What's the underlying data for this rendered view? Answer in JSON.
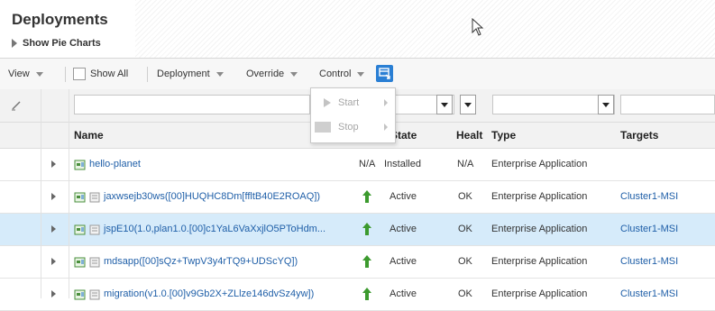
{
  "header": {
    "title": "Deployments",
    "show_pie_charts": "Show Pie Charts"
  },
  "toolbar": {
    "view": "View",
    "show_all": "Show All",
    "deployment": "Deployment",
    "override": "Override",
    "control": "Control"
  },
  "control_menu": {
    "items": [
      "Start",
      "Stop"
    ]
  },
  "table": {
    "columns": [
      "Name",
      "State",
      "Healt",
      "Type",
      "Targets"
    ],
    "rows": [
      {
        "name": "hello-planet",
        "status": "N/A",
        "state": "Installed",
        "health": "N/A",
        "type": "Enterprise Application",
        "targets": ""
      },
      {
        "name": "jaxwsejb30ws([00]HUQHC8Dm[ffltB40E2ROAQ])",
        "status": "up",
        "state": "Active",
        "health": "OK",
        "type": "Enterprise Application",
        "targets": "Cluster1-MSI"
      },
      {
        "name": "jspE10(1.0,plan1.0.[00]c1YaL6VaXxjlO5PToHdm...",
        "status": "up",
        "state": "Active",
        "health": "OK",
        "type": "Enterprise Application",
        "targets": "Cluster1-MSI"
      },
      {
        "name": "mdsapp([00]sQz+TwpV3y4rTQ9+UDScYQ])",
        "status": "up",
        "state": "Active",
        "health": "OK",
        "type": "Enterprise Application",
        "targets": "Cluster1-MSI"
      },
      {
        "name": "migration(v1.0.[00]v9Gb2X+ZLlze146dvSz4yw])",
        "status": "up",
        "state": "Active",
        "health": "OK",
        "type": "Enterprise Application",
        "targets": "Cluster1-MSI"
      }
    ]
  },
  "colors": {
    "link": "#1f5fa8",
    "selected_row": "#d6ebfa",
    "accent": "#2a7fd4",
    "status_up": "#3c9a2e"
  },
  "icons": {
    "status_up": "green-up-arrow-icon",
    "application": "application-icon",
    "document": "document-icon"
  }
}
